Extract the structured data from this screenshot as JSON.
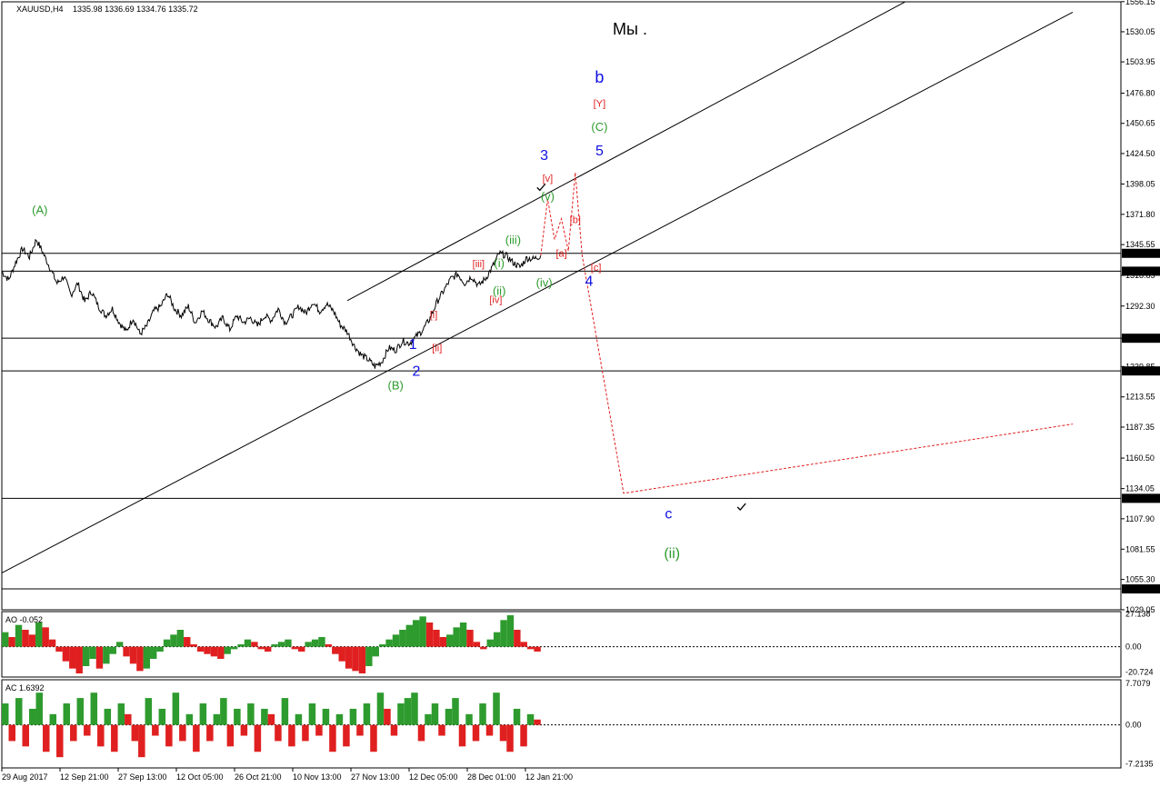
{
  "header": {
    "symbol": "XAUUSD,H4",
    "ohlc": "1335.98 1336.69 1334.76 1335.72"
  },
  "main_title": "Мы .",
  "colors": {
    "green": "#2e9b2e",
    "red": "#e02020",
    "blue": "#1010e0",
    "black": "#000000"
  },
  "chart_data": {
    "type": "line",
    "price_axis": {
      "min": 1029,
      "max": 1556,
      "ticks": [
        1556.15,
        1530.05,
        1503.95,
        1476.8,
        1450.65,
        1424.5,
        1398.05,
        1371.8,
        1345.55,
        1318.85,
        1292.3,
        1264.39,
        1239.85,
        1213.55,
        1187.35,
        1160.5,
        1134.05,
        1107.9,
        1081.55,
        1055.3,
        1029.05
      ]
    },
    "time_labels": [
      "29 Aug 2017",
      "12 Sep 21:00",
      "27 Sep 13:00",
      "12 Oct 05:00",
      "26 Oct 21:00",
      "10 Nov 13:00",
      "27 Nov 13:00",
      "12 Dec 05:00",
      "28 Dec 01:00",
      "12 Jan 21:00"
    ],
    "horizontal_levels": [
      {
        "value": 1338.0,
        "label": "1338.00"
      },
      {
        "value": 1322.5,
        "label": "1322.50"
      },
      {
        "value": 1264.39,
        "label": "1264.39"
      },
      {
        "value": 1236.04,
        "label": "1236.04"
      },
      {
        "value": 1125.6,
        "label": "1125.60"
      },
      {
        "value": 1047.09,
        "label": "1047.09"
      }
    ],
    "price_path": [
      [
        0,
        1322
      ],
      [
        1,
        1315
      ],
      [
        2,
        1330
      ],
      [
        3,
        1342
      ],
      [
        4,
        1335
      ],
      [
        5,
        1350
      ],
      [
        6,
        1338
      ],
      [
        7,
        1325
      ],
      [
        8,
        1312
      ],
      [
        9,
        1318
      ],
      [
        10,
        1302
      ],
      [
        11,
        1312
      ],
      [
        12,
        1296
      ],
      [
        13,
        1305
      ],
      [
        14,
        1292
      ],
      [
        15,
        1284
      ],
      [
        16,
        1290
      ],
      [
        17,
        1278
      ],
      [
        18,
        1270
      ],
      [
        19,
        1282
      ],
      [
        20,
        1268
      ],
      [
        21,
        1275
      ],
      [
        22,
        1288
      ],
      [
        23,
        1292
      ],
      [
        24,
        1303
      ],
      [
        25,
        1290
      ],
      [
        26,
        1284
      ],
      [
        27,
        1292
      ],
      [
        28,
        1278
      ],
      [
        29,
        1288
      ],
      [
        30,
        1280
      ],
      [
        31,
        1274
      ],
      [
        32,
        1282
      ],
      [
        33,
        1272
      ],
      [
        34,
        1284
      ],
      [
        35,
        1278
      ],
      [
        36,
        1282
      ],
      [
        37,
        1275
      ],
      [
        38,
        1284
      ],
      [
        39,
        1280
      ],
      [
        40,
        1290
      ],
      [
        41,
        1278
      ],
      [
        42,
        1284
      ],
      [
        43,
        1292
      ],
      [
        44,
        1286
      ],
      [
        45,
        1296
      ],
      [
        46,
        1288
      ],
      [
        47,
        1294
      ],
      [
        48,
        1288
      ],
      [
        49,
        1276
      ],
      [
        50,
        1270
      ],
      [
        51,
        1258
      ],
      [
        52,
        1250
      ],
      [
        53,
        1246
      ],
      [
        54,
        1240
      ],
      [
        55,
        1244
      ],
      [
        56,
        1256
      ],
      [
        57,
        1254
      ],
      [
        58,
        1262
      ],
      [
        59,
        1260
      ],
      [
        60,
        1266
      ],
      [
        61,
        1272
      ],
      [
        62,
        1282
      ],
      [
        63,
        1296
      ],
      [
        64,
        1306
      ],
      [
        65,
        1316
      ],
      [
        66,
        1320
      ],
      [
        67,
        1312
      ],
      [
        68,
        1318
      ],
      [
        69,
        1310
      ],
      [
        70,
        1316
      ],
      [
        71,
        1326
      ],
      [
        72,
        1338
      ],
      [
        73,
        1336
      ],
      [
        74,
        1330
      ],
      [
        75,
        1326
      ],
      [
        76,
        1334
      ],
      [
        77,
        1333
      ],
      [
        78,
        1336
      ]
    ],
    "projection_path": [
      [
        78,
        1336
      ],
      [
        79,
        1385
      ],
      [
        80,
        1350
      ],
      [
        81,
        1368
      ],
      [
        82,
        1340
      ],
      [
        83,
        1408
      ],
      [
        84,
        1336
      ],
      [
        90,
        1130
      ],
      [
        155,
        1190
      ]
    ],
    "channel_lines": [
      {
        "from": [
          0,
          1061
        ],
        "to": [
          155,
          1547
        ]
      },
      {
        "from": [
          50,
          1297
        ],
        "to": [
          132,
          1560
        ]
      }
    ],
    "wave_labels": [
      {
        "text": "(A)",
        "color": "green",
        "t": 5.5,
        "p": 1372
      },
      {
        "text": "(B)",
        "color": "green",
        "t": 57,
        "p": 1220
      },
      {
        "text": "(C)",
        "color": "green",
        "t": 86.5,
        "p": 1444
      },
      {
        "text": "b",
        "color": "blue",
        "t": 86.5,
        "p": 1486,
        "size": 18
      },
      {
        "text": "[Y]",
        "color": "red",
        "t": 86.5,
        "p": 1465
      },
      {
        "text": "5",
        "color": "blue",
        "t": 86.5,
        "p": 1423
      },
      {
        "text": "3",
        "color": "blue",
        "t": 78.5,
        "p": 1419
      },
      {
        "text": "4",
        "color": "blue",
        "t": 85,
        "p": 1310
      },
      {
        "text": "1",
        "color": "blue",
        "t": 59.5,
        "p": 1255
      },
      {
        "text": "2",
        "color": "blue",
        "t": 60,
        "p": 1232
      },
      {
        "text": "c",
        "color": "blue",
        "t": 96.5,
        "p": 1108,
        "size": 16
      },
      {
        "text": "(ii)",
        "color": "green",
        "t": 97,
        "p": 1074,
        "size": 16
      },
      {
        "text": "[v]",
        "color": "red",
        "t": 79,
        "p": 1400
      },
      {
        "text": "(v)",
        "color": "green",
        "t": 79,
        "p": 1384
      },
      {
        "text": "[b]",
        "color": "red",
        "t": 83,
        "p": 1364
      },
      {
        "text": "[a]",
        "color": "red",
        "t": 81,
        "p": 1335
      },
      {
        "text": "[c]",
        "color": "red",
        "t": 86,
        "p": 1323
      },
      {
        "text": "(iii)",
        "color": "green",
        "t": 74,
        "p": 1346
      },
      {
        "text": "(i)",
        "color": "green",
        "t": 72,
        "p": 1326
      },
      {
        "text": "(ii)",
        "color": "green",
        "t": 72,
        "p": 1302
      },
      {
        "text": "(iv)",
        "color": "green",
        "t": 78.5,
        "p": 1309
      },
      {
        "text": "[iii]",
        "color": "red",
        "t": 69,
        "p": 1326
      },
      {
        "text": "[iv]",
        "color": "red",
        "t": 71.5,
        "p": 1295
      },
      {
        "text": "[i]",
        "color": "red",
        "t": 62.5,
        "p": 1282
      },
      {
        "text": "[ii]",
        "color": "red",
        "t": 63,
        "p": 1253
      }
    ],
    "check_marks": [
      {
        "t": 78,
        "p": 1395
      },
      {
        "t": 107,
        "p": 1118
      }
    ],
    "oscillators": [
      {
        "name": "AO",
        "value": "-0.052",
        "ticks": [
          "27.138",
          "0.00",
          "-20.724"
        ],
        "min": -25,
        "max": 29,
        "values": [
          12,
          8,
          18,
          14,
          10,
          20,
          16,
          6,
          -4,
          -12,
          -18,
          -22,
          -16,
          -10,
          -18,
          -14,
          -6,
          4,
          -8,
          -14,
          -20,
          -18,
          -10,
          -4,
          6,
          10,
          14,
          8,
          2,
          -4,
          -6,
          -8,
          -10,
          -6,
          -2,
          2,
          6,
          4,
          -2,
          -4,
          2,
          4,
          6,
          -2,
          -4,
          4,
          6,
          8,
          2,
          -6,
          -12,
          -18,
          -20,
          -22,
          -16,
          -8,
          2,
          6,
          10,
          14,
          18,
          22,
          25,
          20,
          14,
          8,
          10,
          16,
          20,
          14,
          4,
          -2,
          6,
          12,
          22,
          26,
          14,
          4,
          -2,
          -4
        ]
      },
      {
        "name": "AC",
        "value": "1.6392",
        "ticks": [
          "7.7079",
          "0.00",
          "-7.2135"
        ],
        "min": -8,
        "max": 8.4,
        "values": [
          4,
          -3,
          5,
          -4,
          3,
          6,
          -5,
          2,
          -6,
          4,
          -3,
          5,
          -2,
          6,
          -4,
          3,
          -5,
          4,
          2,
          -3,
          -6,
          5,
          -2,
          3,
          -4,
          6,
          -3,
          2,
          -5,
          4,
          -3,
          2,
          5,
          -4,
          3,
          -2,
          4,
          -5,
          3,
          2,
          -3,
          5,
          -4,
          2,
          -3,
          4,
          -2,
          3,
          -5,
          2,
          -4,
          3,
          -2,
          4,
          -5,
          6,
          3,
          -2,
          4,
          5,
          6,
          -3,
          2,
          4,
          -2,
          3,
          5,
          -4,
          2,
          -3,
          4,
          -2,
          6,
          -3,
          -5,
          3,
          -4,
          2,
          1
        ]
      }
    ]
  }
}
